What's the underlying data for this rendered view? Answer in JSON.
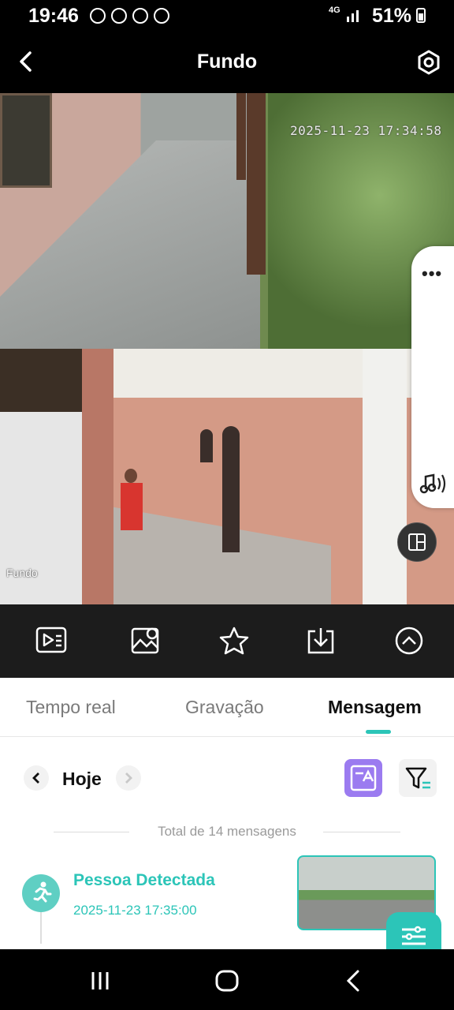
{
  "status_bar": {
    "time": "19:46",
    "network": "4G",
    "battery": "51%"
  },
  "header": {
    "title": "Fundo"
  },
  "video": {
    "timestamp": "2025-11-23 17:34:58",
    "camera_label": "Fundo"
  },
  "tabs": [
    {
      "label": "Tempo real",
      "active": false
    },
    {
      "label": "Gravação",
      "active": false
    },
    {
      "label": "Mensagem",
      "active": true
    }
  ],
  "date_nav": {
    "label": "Hoje"
  },
  "messages": {
    "total_text": "Total de 14 mensagens",
    "items": [
      {
        "title": "Pessoa Detectada",
        "time": "2025-11-23 17:35:00",
        "icon": "person-running-icon"
      }
    ]
  },
  "colors": {
    "accent": "#2cc5b8",
    "translate_button": "#9b7bf0",
    "toolbar_bg": "#1c1c1c"
  }
}
